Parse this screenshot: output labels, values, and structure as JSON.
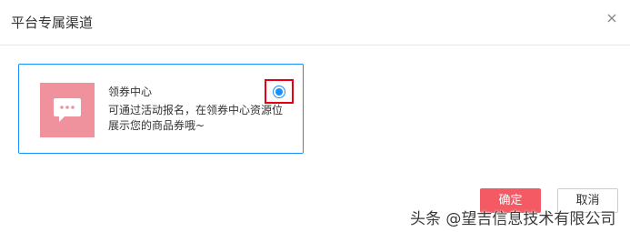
{
  "dialog": {
    "title": "平台专属渠道",
    "close_icon": "close-icon"
  },
  "channel_card": {
    "icon": "chat-bubble-icon",
    "icon_bg_color": "#f0929e",
    "title": "领券中心",
    "description": "可通过活动报名，在领券中心资源位展示您的商品券哦~",
    "selected": true,
    "border_color": "#1890ff",
    "highlight_color": "#e60012"
  },
  "footer": {
    "confirm_label": "确定",
    "cancel_label": "取消",
    "confirm_color": "#f35a63"
  },
  "watermark": {
    "text": "头条 @望吉信息技术有限公司"
  }
}
